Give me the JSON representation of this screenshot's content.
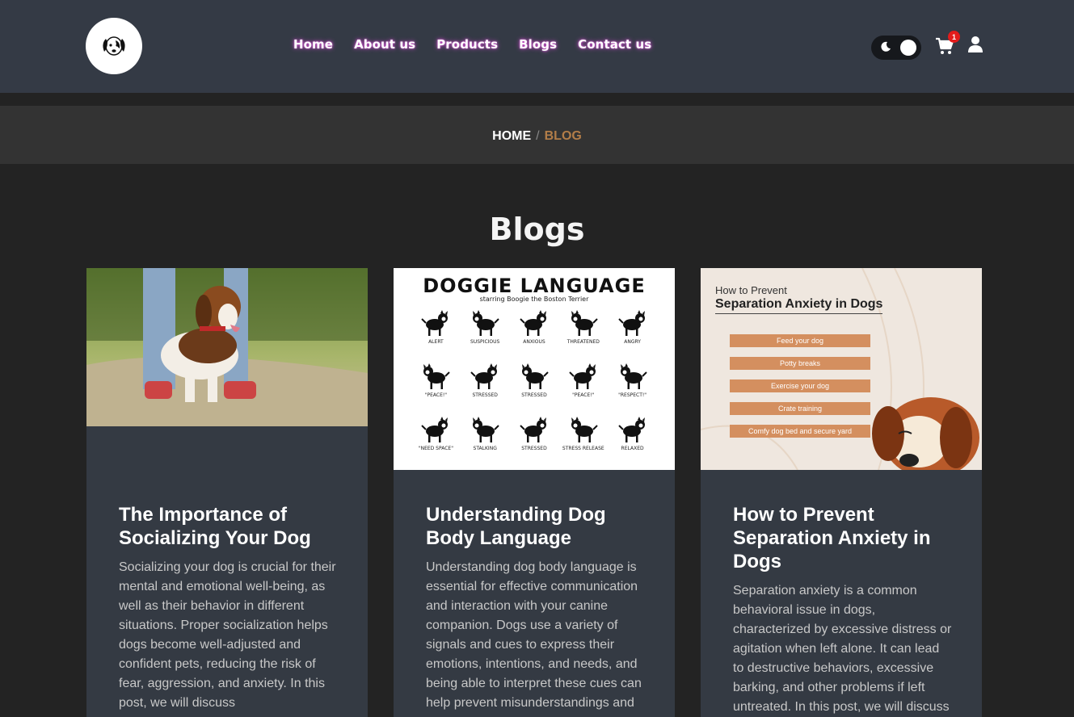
{
  "header": {
    "nav": [
      "Home",
      "About us",
      "Products",
      "Blogs",
      "Contact us"
    ],
    "cart_count": "1",
    "accent": "#d44ad4"
  },
  "breadcrumb": {
    "home": "HOME",
    "separator": "/",
    "current": "BLOG"
  },
  "section": {
    "title": "Blogs"
  },
  "posts": [
    {
      "title": "The Importance of Socializing Your Dog",
      "excerpt": "Socializing your dog is crucial for their mental and emotional well-being, as well as their behavior in different situations. Proper socialization helps dogs become well-adjusted and confident pets, reducing the risk of fear, aggression, and anxiety. In this post, we will discuss"
    },
    {
      "title": "Understanding Dog Body Language",
      "excerpt": "Understanding dog body language is essential for effective communication and interaction with your canine companion. Dogs use a variety of signals and cues to express their emotions, intentions, and needs, and being able to interpret these cues can help prevent misunderstandings and",
      "image": {
        "heading": "DOGGIE LANGUAGE",
        "subheading": "starring Boogie the Boston Terrier",
        "labels": [
          "ALERT",
          "SUSPICIOUS",
          "ANXIOUS",
          "THREATENED",
          "ANGRY",
          "\"PEACE!\"",
          "STRESSED",
          "STRESSED",
          "\"PEACE!\"",
          "\"RESPECT!\"",
          "\"NEED SPACE\"",
          "STALKING",
          "STRESSED",
          "STRESS RELEASE",
          "RELAXED"
        ]
      }
    },
    {
      "title": "How to Prevent Separation Anxiety in Dogs",
      "excerpt": "Separation anxiety is a common behavioral issue in dogs, characterized by excessive distress or agitation when left alone. It can lead to destructive behaviors, excessive barking, and other problems if left untreated. In this post, we will discuss",
      "image": {
        "line1": "How to Prevent",
        "line2": "Separation Anxiety in Dogs",
        "items": [
          "Feed your dog",
          "Potty breaks",
          "Exercise your dog",
          "Crate training",
          "Comfy dog bed and secure yard"
        ]
      }
    }
  ]
}
